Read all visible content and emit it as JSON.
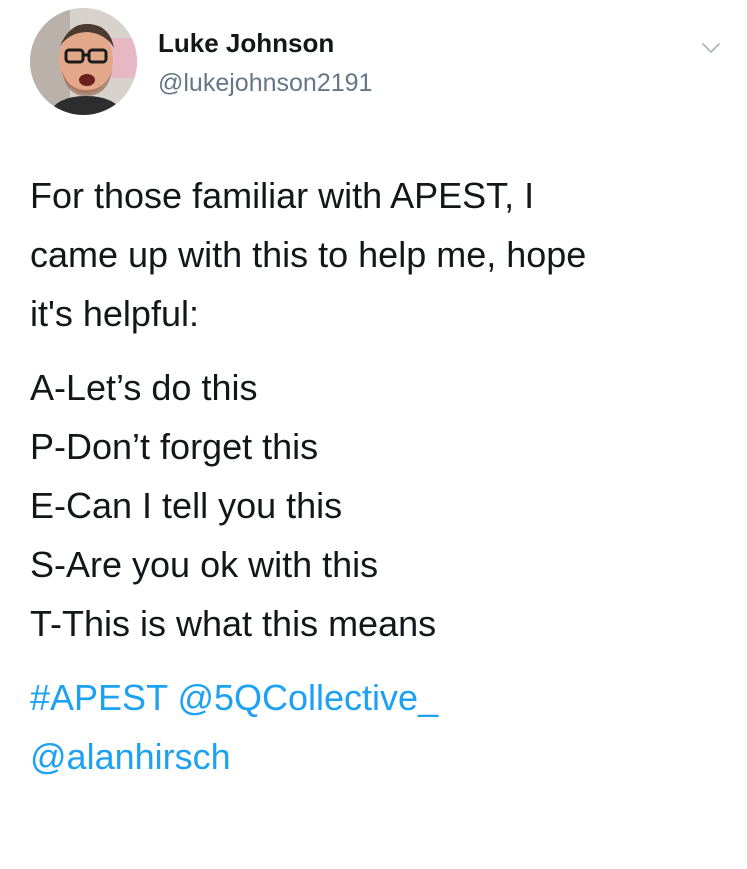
{
  "author": {
    "display_name": "Luke Johnson",
    "handle": "@lukejohnson2191"
  },
  "tweet": {
    "intro_lines": [
      "For those familiar with APEST, I",
      "came up with this to help me, hope",
      "it's helpful:"
    ],
    "list": [
      "A-Let’s do this",
      "P-Don’t forget this",
      "E-Can I tell you this",
      "S-Are you ok with this",
      "T-This is what this means"
    ],
    "hashtag": "#APEST",
    "mention_1": "@5QCollective_",
    "mention_2": "@alanhirsch"
  },
  "colors": {
    "link": "#1da1f2",
    "text": "#14171a",
    "secondary": "#657786"
  },
  "icons": {
    "menu": "chevron-down-icon",
    "avatar": "profile-photo"
  }
}
